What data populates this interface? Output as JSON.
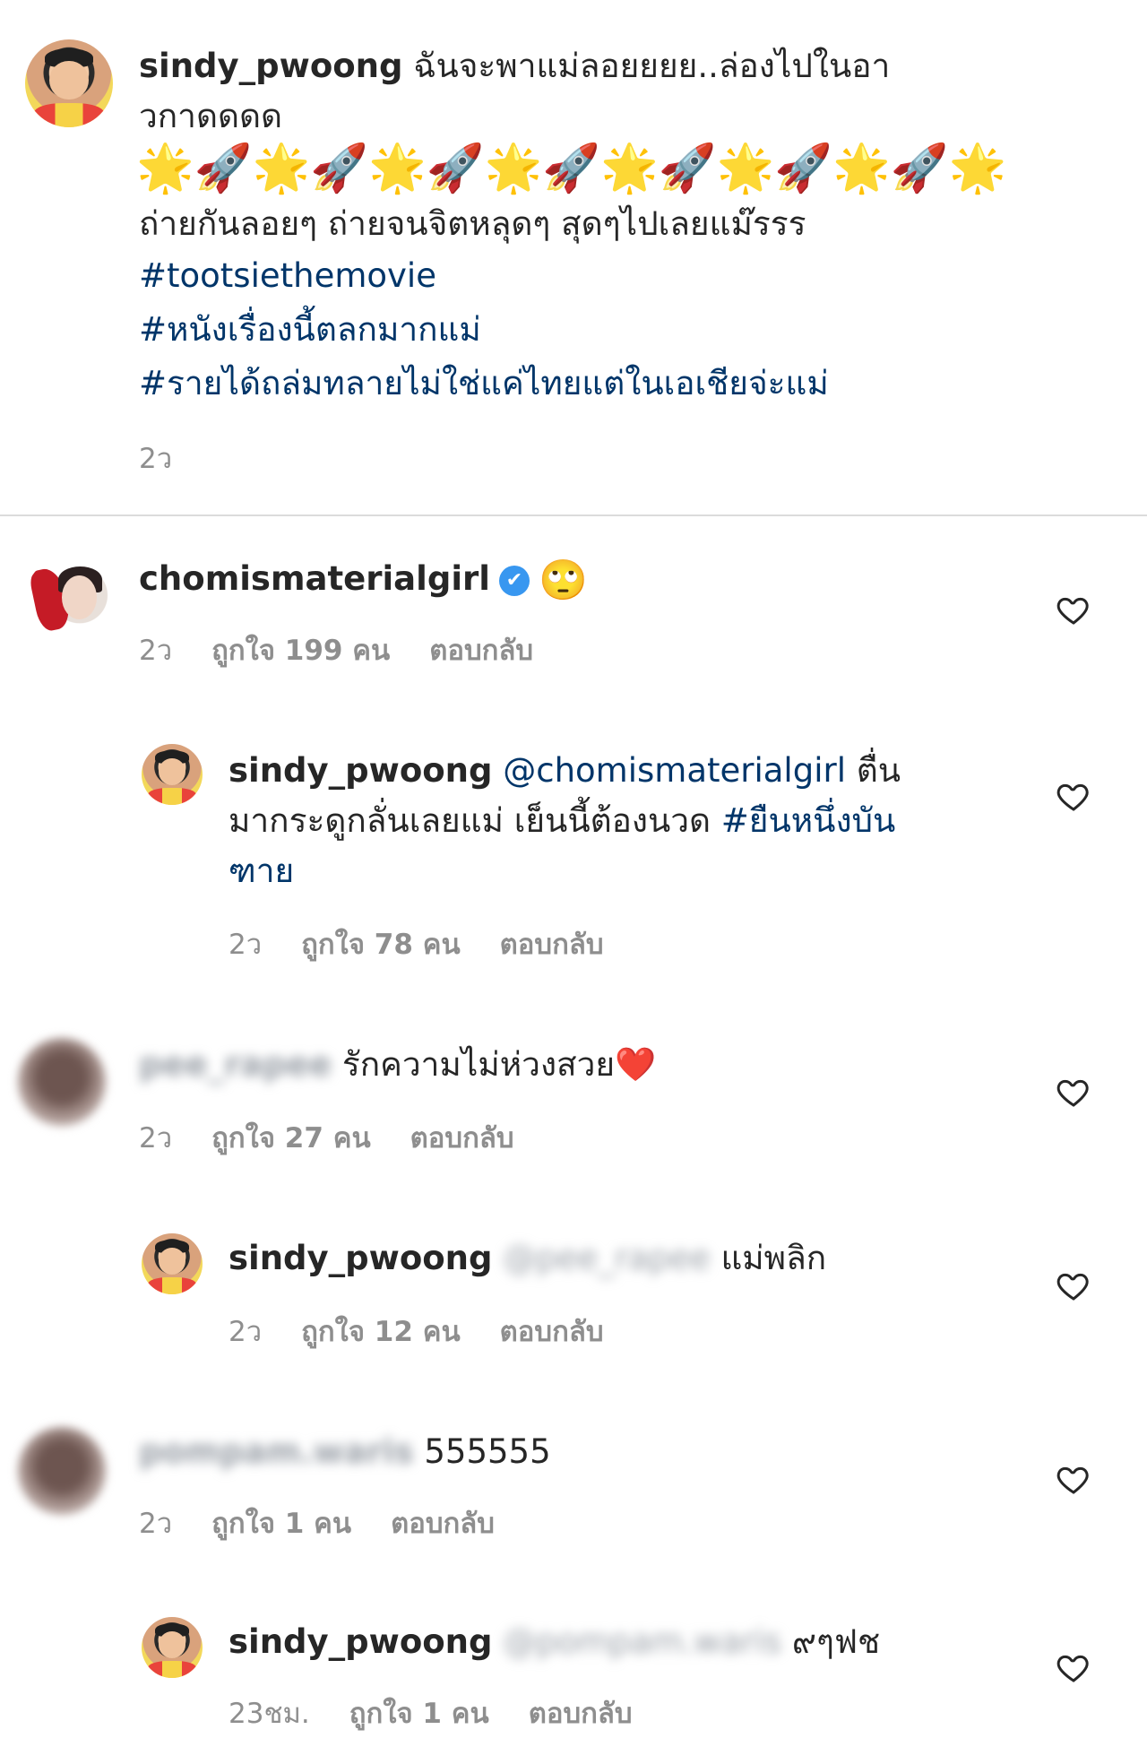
{
  "post": {
    "username": "sindy_pwoong",
    "caption_line1": "ฉันจะพาแม่ลอยยยย..ล่องไปในอา",
    "caption_line2": "วกาดดดด",
    "emoji_row": "🌟🚀🌟🚀🌟🚀🌟🚀🌟🚀🌟🚀🌟🚀🌟",
    "caption_line3": "ถ่ายกันลอยๆ ถ่ายจนจิตหลุดๆ สุดๆไปเลยแม๊รรร",
    "hashtag1": "#tootsiethemovie",
    "hashtag2": "#หนังเรื่องนี้ตลกมากแม่",
    "hashtag3": "#รายได้ถล่มทลายไม่ใช่แค่ไทยแต่ในเอเชียจ่ะแม่",
    "time": "2ว"
  },
  "comments": [
    {
      "username": "chomismaterialgirl",
      "verified_icon": "✔",
      "emoji": "🙄",
      "time": "2ว",
      "likes": "ถูกใจ 199 คน",
      "reply": "ตอบกลับ"
    },
    {
      "username": "sindy_pwoong",
      "mention": "@chomismaterialgirl",
      "text_part1": " ตื่น",
      "text_line2": "มากระดูกลั่นเลยแม่ เย็นนี้ต้องนวด ",
      "hashtag": "#ยืนหนึ่งบัน",
      "hashtag_line3": "ฑาย",
      "time": "2ว",
      "likes": "ถูกใจ 78 คน",
      "reply": "ตอบกลับ"
    },
    {
      "username": "pee_rapee",
      "text": "รักความไม่ห่วงสวย",
      "heart_emoji": "❤️",
      "time": "2ว",
      "likes": "ถูกใจ 27 คน",
      "reply": "ตอบกลับ"
    },
    {
      "username": "sindy_pwoong",
      "mention": "@pee_rapee",
      "text": "แม่พลิก",
      "time": "2ว",
      "likes": "ถูกใจ 12 คน",
      "reply": "ตอบกลับ"
    },
    {
      "username": "pompam.waris",
      "text": "555555",
      "time": "2ว",
      "likes": "ถูกใจ 1 คน",
      "reply": "ตอบกลับ"
    },
    {
      "username": "sindy_pwoong",
      "mention": "@pompam.waris",
      "text": "๙ๆฟช",
      "time": "23ชม.",
      "likes": "ถูกใจ 1 คน",
      "reply": "ตอบกลับ"
    }
  ],
  "icons": {
    "like": "heart-outline-icon"
  },
  "colors": {
    "text": "#262626",
    "muted": "#8e8e8e",
    "hashtag": "#003569",
    "verified": "#3897f0"
  }
}
